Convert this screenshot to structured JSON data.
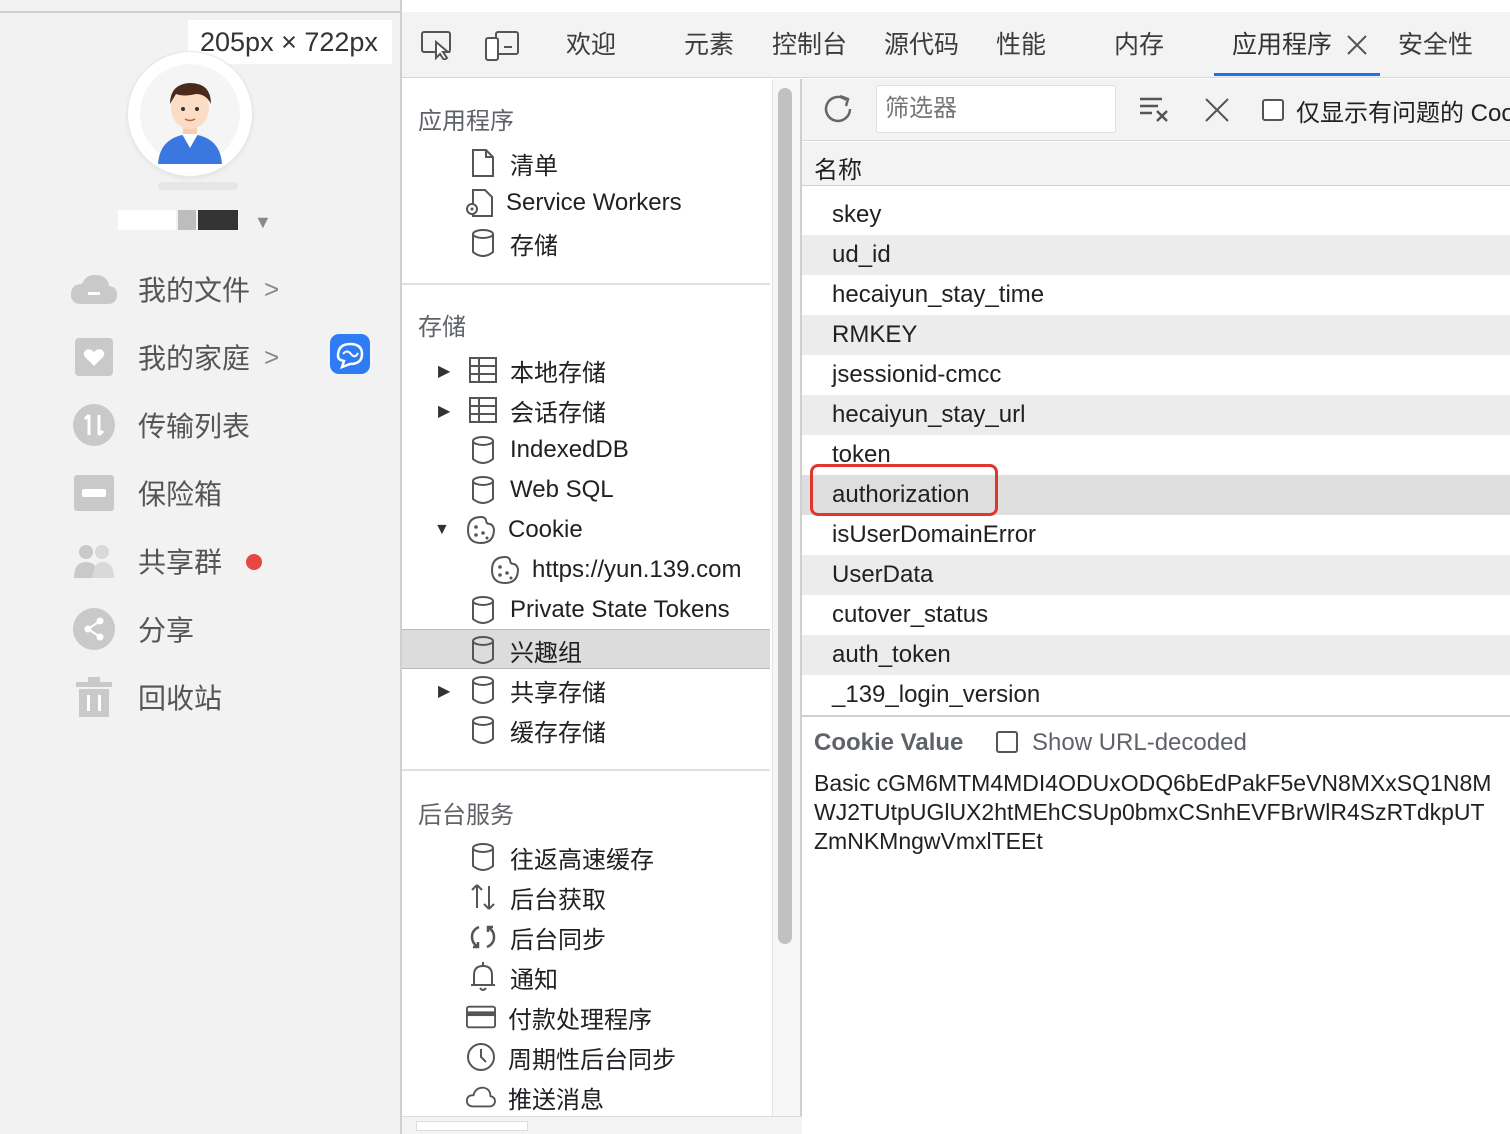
{
  "app": {
    "dimension_tooltip": "205px × 722px",
    "nav": [
      {
        "label": "我的文件",
        "chevron": ">"
      },
      {
        "label": "我的家庭",
        "chevron": ">"
      },
      {
        "label": "传输列表",
        "chevron": ""
      },
      {
        "label": "保险箱",
        "chevron": ""
      },
      {
        "label": "共享群",
        "chevron": ""
      },
      {
        "label": "分享",
        "chevron": ""
      },
      {
        "label": "回收站",
        "chevron": ""
      }
    ],
    "colors": {
      "sidebar_bg": "#f2f2f2",
      "icon_gray": "#c9c9c9",
      "ai_badge": "#2f7bf5",
      "notify_dot": "#e84545"
    }
  },
  "devtools": {
    "tabs": [
      "欢迎",
      "元素",
      "控制台",
      "源代码",
      "性能",
      "内存",
      "应用程序",
      "安全性"
    ],
    "active_tab": "应用程序",
    "sidebar": {
      "sections": [
        {
          "title": "应用程序",
          "items": [
            "清单",
            "Service Workers",
            "存储"
          ]
        },
        {
          "title": "存储",
          "items": [
            "本地存储",
            "会话存储",
            "IndexedDB",
            "Web SQL",
            "Cookie",
            "https://yun.139.com",
            "Private State Tokens",
            "兴趣组",
            "共享存储",
            "缓存存储"
          ]
        },
        {
          "title": "后台服务",
          "items": [
            "往返高速缓存",
            "后台获取",
            "后台同步",
            "通知",
            "付款处理程序",
            "周期性后台同步",
            "推送消息"
          ]
        }
      ],
      "selected_item": "https://yun.139.com"
    },
    "filter": {
      "placeholder": "筛选器",
      "only_issues_label": "仅显示有问题的 Coo"
    },
    "table": {
      "column": "名称",
      "rows": [
        "skey",
        "ud_id",
        "hecaiyun_stay_time",
        "RMKEY",
        "jsessionid-cmcc",
        "hecaiyun_stay_url",
        "token",
        "authorization",
        "isUserDomainError",
        "UserData",
        "cutover_status",
        "auth_token",
        "_139_login_version"
      ],
      "selected_row": "authorization"
    },
    "cookie_value": {
      "title": "Cookie Value",
      "show_decoded_label": "Show URL-decoded",
      "lines": [
        "Basic cGM6MTM4MDI4ODUxODQ6bEdPakF5eVN8MXxSQ1N8M",
        "WJ2TUtpUGlUX2htMEhCSUp0bmxCSnhEVFBrWlR4SzRTdkpUT",
        "ZmNKMngwVmxlTEEt"
      ]
    },
    "colors": {
      "accent": "#1a73e8",
      "highlight_box": "#e0362c",
      "selected_bg": "#dcdcdc"
    }
  }
}
